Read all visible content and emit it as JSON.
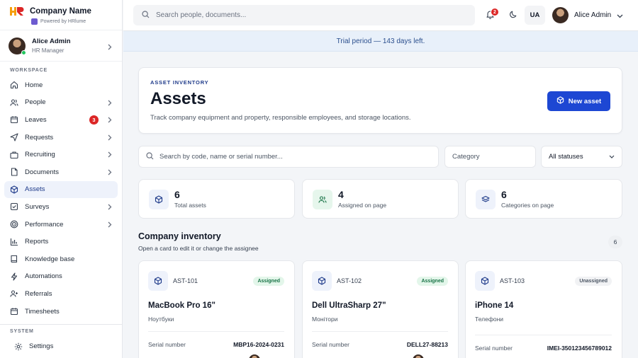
{
  "sidebar": {
    "brand_name": "Company Name",
    "powered_by": "Powered by HRlume",
    "user": {
      "name": "Alice Admin",
      "role": "HR Manager"
    },
    "workspace_label": "WORKSPACE",
    "items": [
      {
        "label": "Home",
        "icon": "home-icon",
        "chevron": false
      },
      {
        "label": "People",
        "icon": "people-icon",
        "chevron": true
      },
      {
        "label": "Leaves",
        "icon": "calendar-icon",
        "chevron": true,
        "badge": "3"
      },
      {
        "label": "Requests",
        "icon": "send-icon",
        "chevron": true
      },
      {
        "label": "Recruiting",
        "icon": "briefcase-icon",
        "chevron": true
      },
      {
        "label": "Documents",
        "icon": "document-icon",
        "chevron": true
      },
      {
        "label": "Assets",
        "icon": "box-icon",
        "chevron": false,
        "active": true
      },
      {
        "label": "Surveys",
        "icon": "checkbox-icon",
        "chevron": true
      },
      {
        "label": "Performance",
        "icon": "target-icon",
        "chevron": true
      },
      {
        "label": "Reports",
        "icon": "bar-chart-icon",
        "chevron": false
      },
      {
        "label": "Knowledge base",
        "icon": "book-icon",
        "chevron": false
      },
      {
        "label": "Automations",
        "icon": "lightning-icon",
        "chevron": false
      },
      {
        "label": "Referrals",
        "icon": "referral-icon",
        "chevron": false
      },
      {
        "label": "Timesheets",
        "icon": "calendar-icon",
        "chevron": false
      }
    ],
    "system_label": "SYSTEM",
    "system_items": [
      {
        "label": "Settings",
        "icon": "gear-icon"
      }
    ]
  },
  "topbar": {
    "search_placeholder": "Search people, documents...",
    "notification_count": "2",
    "language": "UA",
    "user_name": "Alice Admin"
  },
  "trial_banner": "Trial period — 143 days left.",
  "header": {
    "eyebrow": "ASSET INVENTORY",
    "title": "Assets",
    "subtitle": "Track company equipment and property, responsible employees, and storage locations.",
    "new_button": "New asset"
  },
  "filters": {
    "search_placeholder": "Search by code, name or serial number...",
    "category_placeholder": "Category",
    "status_value": "All statuses"
  },
  "stats": [
    {
      "value": "6",
      "label": "Total assets",
      "icon": "box-icon",
      "color": "#eef2fb"
    },
    {
      "value": "4",
      "label": "Assigned on page",
      "icon": "people-icon",
      "color": "#e6f6ec"
    },
    {
      "value": "6",
      "label": "Categories on page",
      "icon": "layers-icon",
      "color": "#eef2fb"
    }
  ],
  "inventory": {
    "title": "Company inventory",
    "subtitle": "Open a card to edit it or change the assignee",
    "count": "6",
    "serial_label": "Serial number",
    "assets": [
      {
        "code": "AST-101",
        "status": "Assigned",
        "name": "MacBook Pro 16\"",
        "category": "Ноутбуки",
        "serial": "MBP16-2024-0231"
      },
      {
        "code": "AST-102",
        "status": "Assigned",
        "name": "Dell UltraSharp 27\"",
        "category": "Монітори",
        "serial": "DELL27-88213"
      },
      {
        "code": "AST-103",
        "status": "Unassigned",
        "name": "iPhone 14",
        "category": "Телефони",
        "serial": "IMEI-350123456789012"
      }
    ]
  },
  "colors": {
    "accent": "#1d47d3",
    "active_nav_bg": "#eef2fb",
    "badge_red": "#dc2626",
    "banner_bg": "#e8f0fa",
    "assigned_green": "#177245"
  }
}
